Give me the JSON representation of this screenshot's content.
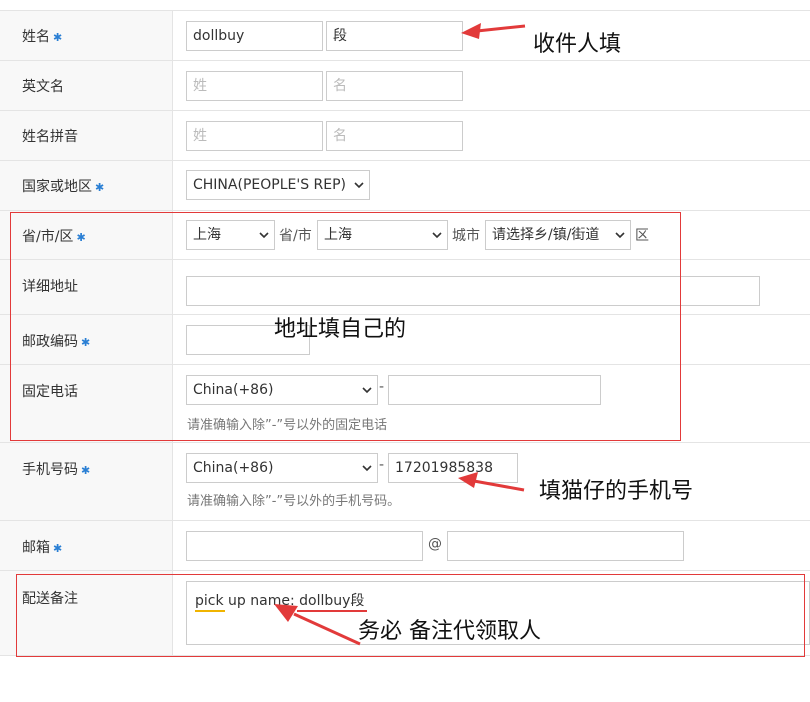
{
  "form": {
    "name": {
      "label": "姓名",
      "required_mark": "✱",
      "first_value": "dollbuy",
      "last_value": "段"
    },
    "english_name": {
      "label": "英文名",
      "surname_placeholder": "姓",
      "given_placeholder": "名"
    },
    "pinyin_name": {
      "label": "姓名拼音",
      "surname_placeholder": "姓",
      "given_placeholder": "名"
    },
    "country": {
      "label": "国家或地区",
      "required_mark": "✱",
      "selected": "CHINA(PEOPLE'S REP)"
    },
    "region": {
      "label": "省/市/区",
      "required_mark": "✱",
      "province_selected": "上海",
      "province_suffix": "省/市",
      "city_selected": "上海",
      "city_suffix": "城市",
      "district_selected": "请选择乡/镇/街道",
      "district_suffix": "区"
    },
    "address": {
      "label": "详细地址",
      "value": ""
    },
    "postcode": {
      "label": "邮政编码",
      "required_mark": "✱",
      "value": ""
    },
    "landline": {
      "label": "固定电话",
      "country_code": "China(+86)",
      "separator": "-",
      "value": "",
      "hint": "请准确输入除”-”号以外的固定电话"
    },
    "mobile": {
      "label": "手机号码",
      "required_mark": "✱",
      "country_code": "China(+86)",
      "separator": "-",
      "value": "17201985838",
      "hint": "请准确输入除”-”号以外的手机号码。"
    },
    "email": {
      "label": "邮箱",
      "required_mark": "✱",
      "user": "",
      "at": "@",
      "domain": ""
    },
    "delivery_note": {
      "label": "配送备注",
      "value": "pick up name: dollbuy段"
    }
  },
  "annotations": {
    "recipient": "收件人填",
    "address": "地址填自己的",
    "phone": "填猫仔的手机号",
    "note": "务必 备注代领取人"
  },
  "colors": {
    "required": "#2a7fd4",
    "annotation_red": "#e23a3a",
    "underline_yellow": "#f0b400",
    "label_bg": "#f8f8f8",
    "border": "#cccccc"
  }
}
